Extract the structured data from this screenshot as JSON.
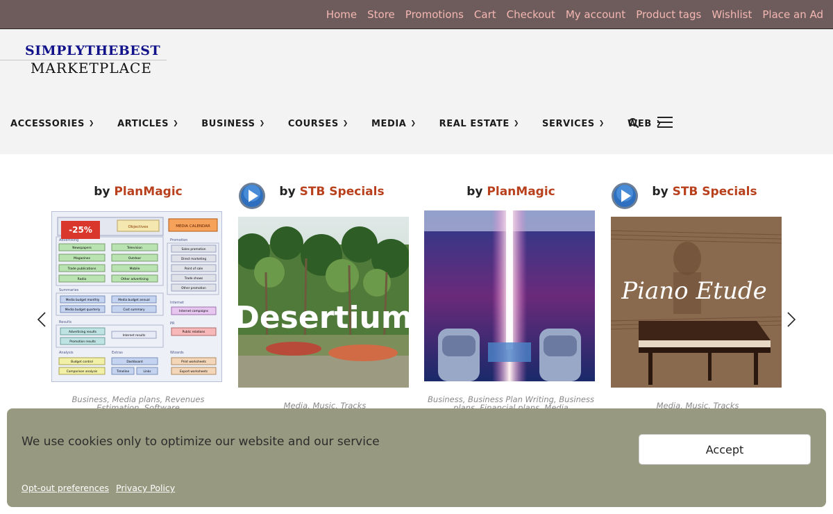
{
  "topnav": [
    "Home",
    "Store",
    "Promotions",
    "Cart",
    "Checkout",
    "My account",
    "Product tags",
    "Wishlist",
    "Place an Ad"
  ],
  "logo": {
    "line1": "SIMPLYTHEBEST",
    "line2": "MARKETPLACE"
  },
  "mainnav": [
    "ACCESSORIES",
    "ARTICLES",
    "BUSINESS",
    "COURSES",
    "MEDIA",
    "REAL ESTATE",
    "SERVICES",
    "WEB"
  ],
  "icons": {
    "search": "search-icon",
    "menu": "hamburger-menu-icon",
    "prev": "chevron-left-icon",
    "next": "chevron-right-icon",
    "play": "play-icon"
  },
  "products": [
    {
      "by": "by",
      "vendor": "PlanMagic",
      "badge": "-25%",
      "categories": "Business, Media plans, Revenues Estimation, Software",
      "image_labels": [
        "Objectives",
        "MEDIA CALENDAR",
        "Advertising",
        "Newspapers",
        "Television",
        "Magazines",
        "Outdoor",
        "Trade publications",
        "Mobile",
        "Radio",
        "Other advertising",
        "Summaries",
        "Media budget monthly",
        "Media budget annual",
        "Media budget quarterly",
        "Cost summary",
        "Results",
        "Advertising results",
        "Internet results",
        "Promotion results",
        "Analysis",
        "Budget control",
        "Comparison analysis",
        "Extras",
        "Dashboard",
        "Timeline",
        "Links",
        "Promotion",
        "Sales promotion",
        "Direct marketing",
        "Point of sale",
        "Trade shows",
        "Other promotion",
        "Internet",
        "Internet campaigns",
        "PR",
        "Public relations",
        "Wizards",
        "Print worksheets",
        "Export worksheets"
      ]
    },
    {
      "by": "by",
      "vendor": "STB Specials",
      "image_title": "Desertium",
      "categories": "Media, Music, Tracks"
    },
    {
      "by": "by",
      "vendor": "PlanMagic",
      "categories": "Business, Business Plan Writing, Business plans, Financial plans, Media"
    },
    {
      "by": "by",
      "vendor": "STB Specials",
      "image_title": "Piano Etude",
      "categories": "Media, Music, Tracks"
    }
  ],
  "cookie": {
    "message": "We use cookies only to optimize our website and our service",
    "accept": "Accept",
    "opt_out": "Opt-out preferences",
    "privacy": "Privacy Policy"
  },
  "colors": {
    "topbar": "#6e5c5c",
    "toplink": "#f4b7b2",
    "vendor": "#b8401c",
    "cookie_bg": "#979a80",
    "badge": "#d9362c"
  }
}
